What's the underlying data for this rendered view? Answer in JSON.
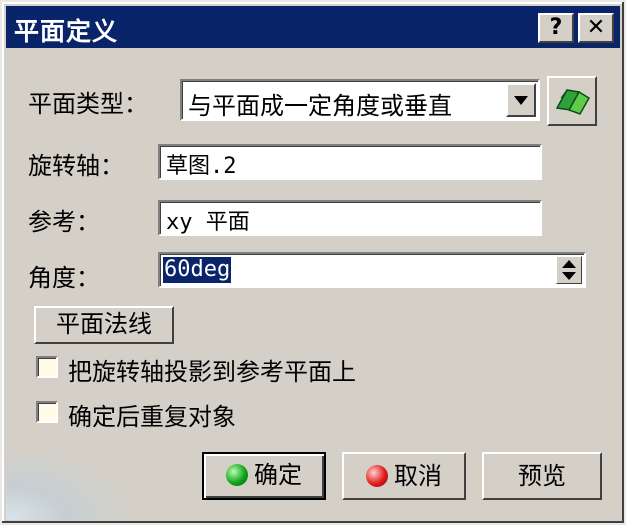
{
  "window": {
    "title": "平面定义",
    "help_label": "?",
    "close_label": "✕"
  },
  "form": {
    "plane_type_label": "平面类型：",
    "plane_type_value": "与平面成一定角度或垂直",
    "rotation_axis_label": "旋转轴：",
    "rotation_axis_value": "草图.2",
    "reference_label": "参考：",
    "reference_value": "xy 平面",
    "angle_label": "角度：",
    "angle_value": "60deg",
    "normal_button": "平面法线",
    "checkbox_project": "把旋转轴投影到参考平面上",
    "checkbox_repeat": "确定后重复对象"
  },
  "buttons": {
    "ok": "确定",
    "cancel": "取消",
    "preview": "预览"
  },
  "icons": {
    "ok": "green-dot-icon",
    "cancel": "red-dot-icon",
    "plane_tool": "green-plane-icon",
    "dropdown": "chevron-down-icon",
    "spin": "spin-updown-icon"
  },
  "colors": {
    "titlebar": "#0a246a",
    "face": "#d4d0c8",
    "selection": "#0a246a"
  }
}
